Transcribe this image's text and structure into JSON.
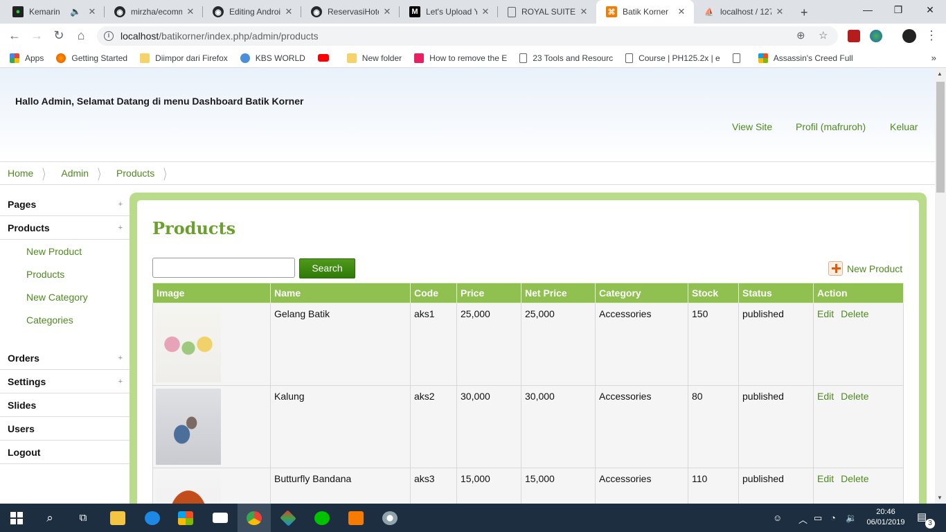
{
  "browser": {
    "tabs": [
      {
        "title": "Kemarin",
        "icon": "app-icon",
        "muted": true
      },
      {
        "title": "mirzha/ecomm",
        "icon": "github-icon"
      },
      {
        "title": "Editing Androi",
        "icon": "github-icon"
      },
      {
        "title": "ReservasiHotel",
        "icon": "github-icon"
      },
      {
        "title": "Let's Upload Yo",
        "icon": "medium-icon"
      },
      {
        "title": "ROYAL SUITE",
        "icon": "doc-icon"
      },
      {
        "title": "Batik Korner",
        "icon": "xampp-icon",
        "active": true
      },
      {
        "title": "localhost / 127",
        "icon": "phpmyadmin-icon"
      }
    ],
    "url_host": "localhost",
    "url_path": "/batikorner/index.php/admin/products",
    "bookmarks": [
      {
        "label": "Apps",
        "icon": "apps-grid-icon"
      },
      {
        "label": "Getting Started",
        "icon": "firefox-icon"
      },
      {
        "label": "Diimpor dari Firefox",
        "icon": "folder-icon"
      },
      {
        "label": "KBS WORLD",
        "icon": "kbs-icon"
      },
      {
        "label": "",
        "icon": "youtube-icon"
      },
      {
        "label": "New folder",
        "icon": "folder-icon"
      },
      {
        "label": "How to remove the E",
        "icon": "site-icon"
      },
      {
        "label": "23 Tools and Resourc",
        "icon": "page-icon"
      },
      {
        "label": "Course | PH125.2x | e",
        "icon": "page-icon"
      },
      {
        "label": "",
        "icon": "page-icon"
      },
      {
        "label": "Assassin's Creed Full",
        "icon": "windows-icon"
      }
    ]
  },
  "header": {
    "welcome": "Hallo Admin, Selamat Datang di menu Dashboard Batik Korner",
    "links": [
      "View Site",
      "Profil (mafruroh)",
      "Keluar"
    ]
  },
  "breadcrumb": [
    "Home",
    "Admin",
    "Products"
  ],
  "sidebar": {
    "sections": [
      {
        "label": "Pages",
        "expandable": true
      },
      {
        "label": "Products",
        "expandable": true,
        "items": [
          "New Product",
          "Products",
          "New Category",
          "Categories"
        ]
      },
      {
        "label": "Orders",
        "expandable": true
      },
      {
        "label": "Settings",
        "expandable": true
      },
      {
        "label": "Slides",
        "expandable": false
      },
      {
        "label": "Users",
        "expandable": false
      },
      {
        "label": "Logout",
        "expandable": false
      }
    ],
    "plus": "+"
  },
  "main": {
    "title": "Products",
    "search_value": "",
    "search_button": "Search",
    "new_product": "New Product",
    "columns": [
      "Image",
      "Name",
      "Code",
      "Price",
      "Net Price",
      "Category",
      "Stock",
      "Status",
      "Action"
    ],
    "rows": [
      {
        "name": "Gelang Batik",
        "code": "aks1",
        "price": "25,000",
        "net_price": "25,000",
        "category": "Accessories",
        "stock": "150",
        "status": "published",
        "edit": "Edit",
        "delete": "Delete"
      },
      {
        "name": "Kalung",
        "code": "aks2",
        "price": "30,000",
        "net_price": "30,000",
        "category": "Accessories",
        "stock": "80",
        "status": "published",
        "edit": "Edit",
        "delete": "Delete"
      },
      {
        "name": "Butturfly Bandana",
        "code": "aks3",
        "price": "15,000",
        "net_price": "15,000",
        "category": "Accessories",
        "stock": "110",
        "status": "published",
        "edit": "Edit",
        "delete": "Delete"
      }
    ]
  },
  "taskbar": {
    "time": "20:46",
    "date": "06/01/2019",
    "notifications": "3"
  },
  "colors": {
    "accent_green": "#4e8a1e",
    "table_header": "#8fc050",
    "frame_green": "#b9dc8b"
  }
}
